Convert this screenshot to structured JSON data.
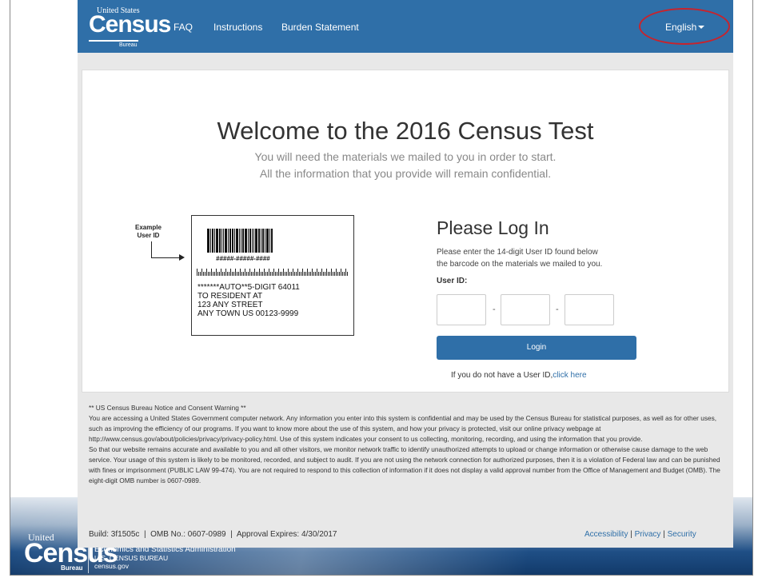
{
  "nav": {
    "logo_united_states": "United States",
    "logo_census": "Census",
    "logo_bureau": "Bureau",
    "links": [
      "FAQ",
      "Instructions",
      "Burden Statement"
    ],
    "language": "English"
  },
  "main": {
    "welcome_title": "Welcome to the 2016 Census Test",
    "subtitle_1": "You will need the materials we mailed to you in order to start.",
    "subtitle_2": "All the information that you provide will remain confidential."
  },
  "example": {
    "label_line1": "Example",
    "label_line2": "User ID",
    "id_mask": "#####-#####-####",
    "address": [
      "*******AUTO**5-DIGIT 64011",
      "TO RESIDENT AT",
      "123 ANY STREET",
      "ANY TOWN US 00123-9999"
    ]
  },
  "login": {
    "title": "Please Log In",
    "desc_1": "Please enter the 14-digit User ID found below",
    "desc_2": "the barcode on the materials we mailed to you.",
    "userid_label": "User ID:",
    "dash": "-",
    "button_label": "Login",
    "no_id_text": "If you do not have a User ID,",
    "click_here": "click here"
  },
  "notice": {
    "heading": "** US Census Bureau Notice and Consent Warning **",
    "para_1": "You are accessing a United States Government computer network. Any information you enter into this system is confidential and may be used by the Census Bureau for statistical purposes, as well as for other uses, such as improving the efficiency of our programs. If you want to know more about the use of this system, and how your privacy is protected, visit our online privacy webpage at http://www.census.gov/about/policies/privacy/privacy-policy.html. Use of this system indicates your consent to us collecting, monitoring, recording, and using the information that you provide.",
    "para_2": "So that our website remains accurate and available to you and all other visitors, we monitor network traffic to identify unauthorized attempts to upload or change information or otherwise cause damage to the web service. Your usage of this system is likely to be monitored, recorded, and subject to audit. If you are not using the network connection for authorized purposes, then it is a violation of Federal law and can be punished with fines or imprisonment (PUBLIC LAW 99-474). You are not required to respond to this collection of information if it does not display a valid approval number from the Office of Management and Budget (OMB). The eight-digit OMB number is 0607-0989."
  },
  "footer": {
    "build": "Build: 3f1505c",
    "omb": "OMB No.: 0607-0989",
    "approval": "Approval Expires: 4/30/2017",
    "sep": "|",
    "links": [
      "Accessibility",
      "Privacy",
      "Security"
    ]
  },
  "slide_footer": {
    "united": "United",
    "census": "Census",
    "bureau": "Bureau",
    "line1": "Economics and Statistics Administration",
    "line2": "U.S. CENSUS BUREAU",
    "line3": "census.gov"
  },
  "colors": {
    "brand_blue": "#2f6fa8",
    "highlight_red": "#c8232c"
  }
}
